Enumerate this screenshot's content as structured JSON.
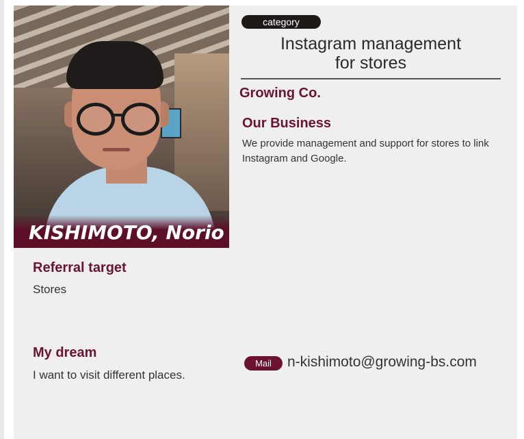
{
  "profile": {
    "name": "KISHIMOTO, Norio",
    "category_label": "category",
    "headline_line1": "Instagram management",
    "headline_line2": "for stores",
    "company": "Growing Co.",
    "business_title": "Our Business",
    "business_text": "We provide management and support for stores to link Instagram and Google.",
    "referral_title": "Referral target",
    "referral_text": "Stores",
    "dream_title": "My dream",
    "dream_text": "I want to visit different places.",
    "mail_label": "Mail",
    "email": "n-kishimoto@growing-bs.com"
  },
  "colors": {
    "accent": "#6b1331",
    "card_background": "#efefef",
    "category_pill": "#1e1a1a"
  }
}
